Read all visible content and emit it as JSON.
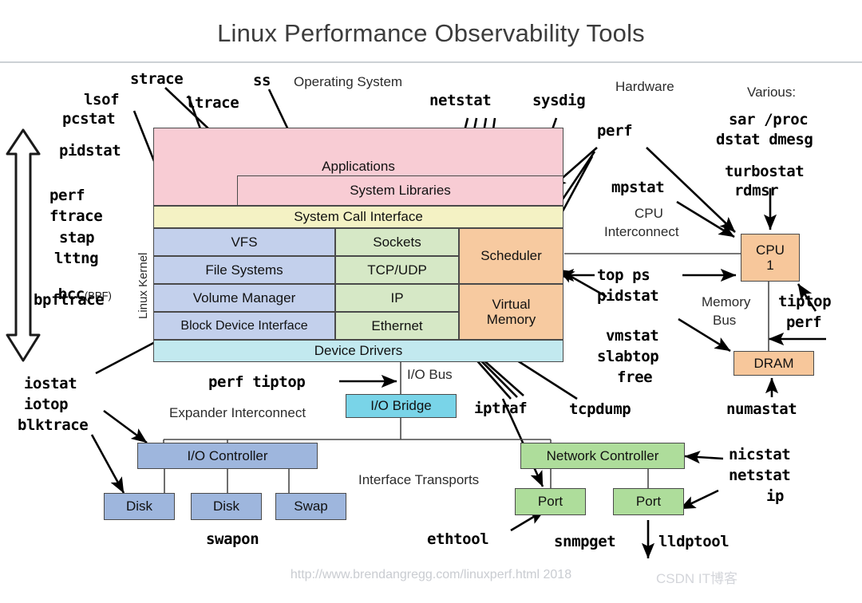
{
  "title": "Linux Performance Observability Tools",
  "section_labels": {
    "operating_system": "Operating System",
    "hardware": "Hardware",
    "various": "Various:",
    "cpu_interconnect_1": "CPU",
    "cpu_interconnect_2": "Interconnect",
    "memory_bus_1": "Memory",
    "memory_bus_2": "Bus",
    "io_bus": "I/O Bus",
    "expander_interconnect": "Expander Interconnect",
    "interface_transports": "Interface Transports",
    "linux_kernel": "Linux Kernel"
  },
  "stack": {
    "applications": "Applications",
    "system_libraries": "System Libraries",
    "system_call_interface": "System Call Interface",
    "vfs": "VFS",
    "file_systems": "File Systems",
    "volume_manager": "Volume Manager",
    "block_device_interface": "Block Device Interface",
    "sockets": "Sockets",
    "tcp_udp": "TCP/UDP",
    "ip": "IP",
    "ethernet": "Ethernet",
    "scheduler": "Scheduler",
    "virtual_memory_1": "Virtual",
    "virtual_memory_2": "Memory",
    "device_drivers": "Device Drivers"
  },
  "hardware_boxes": {
    "cpu_1": "CPU",
    "cpu_2": "1",
    "dram": "DRAM",
    "io_bridge": "I/O Bridge",
    "io_controller": "I/O Controller",
    "disk_1": "Disk",
    "disk_2": "Disk",
    "swap": "Swap",
    "network_controller": "Network Controller",
    "port_1": "Port",
    "port_2": "Port"
  },
  "tools": {
    "strace": "strace",
    "ss": "ss",
    "lsof": "lsof",
    "pcstat": "pcstat",
    "ltrace": "ltrace",
    "pidstat": "pidstat",
    "netstat_top": "netstat",
    "sysdig": "sysdig",
    "perf_hw": "perf",
    "sar_proc": "sar /proc",
    "dstat_dmesg": "dstat dmesg",
    "turbostat": "turbostat",
    "rdmsr": "rdmsr",
    "mpstat": "mpstat",
    "perf_left": "perf",
    "ftrace": "ftrace",
    "stap": "stap",
    "lttng": "lttng",
    "bcc": "bcc",
    "bcc_suffix": "(BPF)",
    "bpftrace": "bpftrace",
    "top_ps": "top ps",
    "pidstat_right": "pidstat",
    "tiptop_right": "tiptop",
    "perf_right": "perf",
    "vmstat": "vmstat",
    "slabtop": "slabtop",
    "free": "free",
    "numastat": "numastat",
    "iostat": "iostat",
    "iotop": "iotop",
    "blktrace": "blktrace",
    "perf_tiptop": "perf tiptop",
    "iptraf": "iptraf",
    "tcpdump": "tcpdump",
    "swapon": "swapon",
    "ethtool": "ethtool",
    "snmpget": "snmpget",
    "lldptool": "lldptool",
    "nicstat": "nicstat",
    "netstat_right": "netstat",
    "ip": "ip"
  },
  "footer": {
    "url": "http://www.brendangregg.com/linuxperf.html 2018",
    "watermark": "CSDN IT博客"
  },
  "colors": {
    "applications": "#f8ccd4",
    "syscall": "#f4f2c4",
    "fs_stack": "#c3d0ec",
    "net_stack": "#d6e8c6",
    "cpu_mem_stack": "#f7caa0",
    "device_drivers": "#c2e9ef",
    "io_bridge": "#79d4e8",
    "io_boxes": "#9eb6dd",
    "net_boxes": "#aedd9b",
    "hw_boxes": "#f7c79b",
    "stroke": "#4a4a4a"
  }
}
